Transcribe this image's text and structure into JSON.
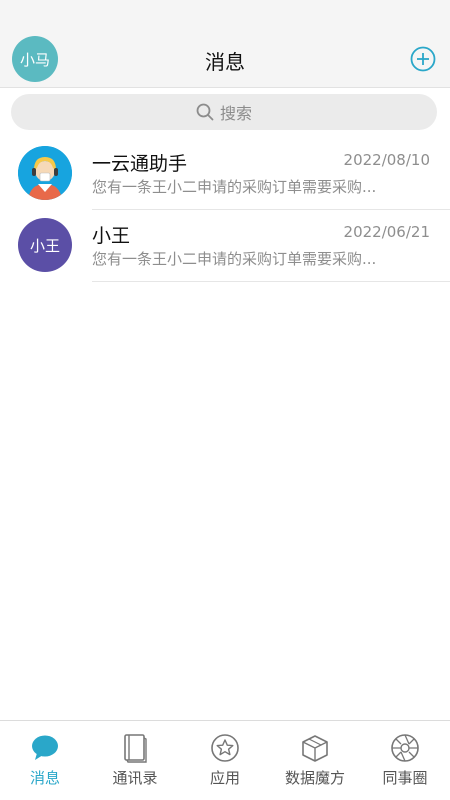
{
  "header": {
    "avatar_text": "小马",
    "title": "消息"
  },
  "search": {
    "placeholder": "搜索"
  },
  "conversations": [
    {
      "name": "一云通助手",
      "date": "2022/08/10",
      "preview": "您有一条王小二申请的采购订单需要采购..."
    },
    {
      "name": "小王",
      "avatar_text": "小王",
      "date": "2022/06/21",
      "preview": "您有一条王小二申请的采购订单需要采购..."
    }
  ],
  "tabs": [
    {
      "label": "消息",
      "icon": "chat-bubble-icon",
      "active": true
    },
    {
      "label": "通讯录",
      "icon": "book-icon",
      "active": false
    },
    {
      "label": "应用",
      "icon": "star-icon",
      "active": false
    },
    {
      "label": "数据魔方",
      "icon": "cube-icon",
      "active": false
    },
    {
      "label": "同事圈",
      "icon": "aperture-icon",
      "active": false
    }
  ],
  "colors": {
    "accent": "#2aa7c9",
    "avatar_me": "#5bbac1",
    "avatar_wang": "#5b4fa6"
  }
}
